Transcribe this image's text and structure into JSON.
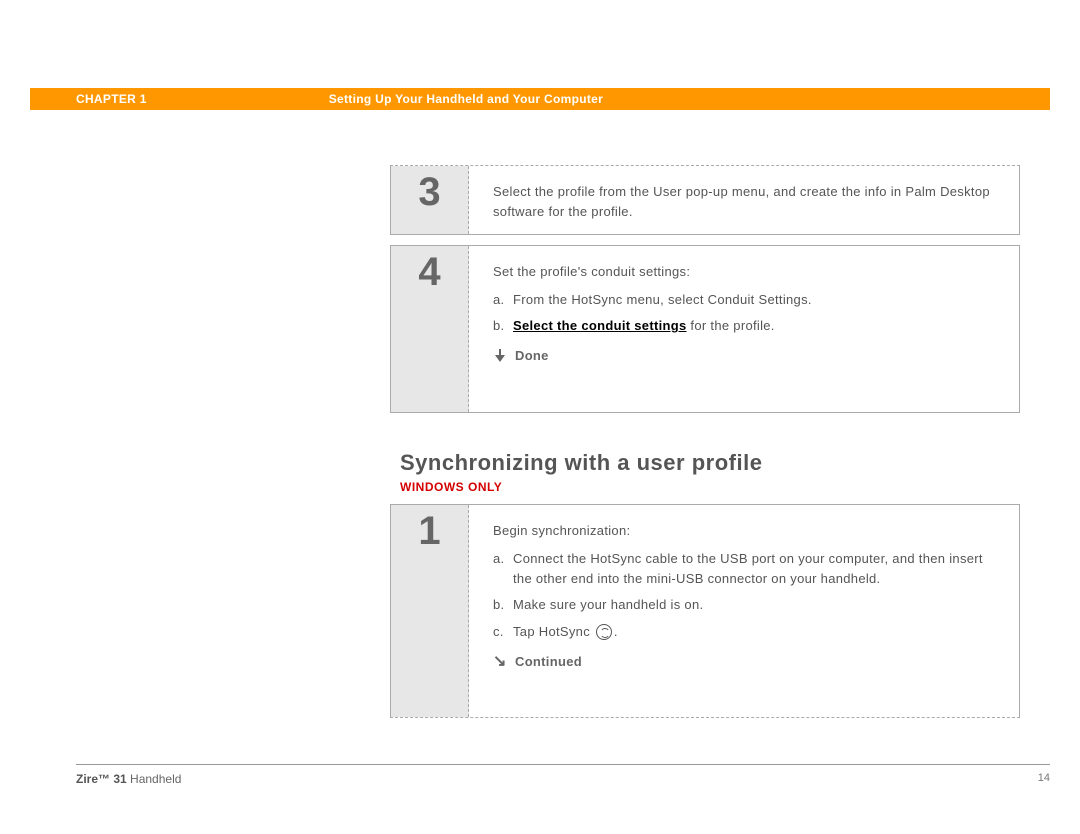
{
  "header": {
    "chapter": "CHAPTER 1",
    "title": "Setting Up Your Handheld and Your Computer"
  },
  "step3": {
    "num": "3",
    "text": "Select the profile from the User pop-up menu, and create the info in Palm Desktop software for the profile."
  },
  "step4": {
    "num": "4",
    "intro": "Set the profile's conduit settings:",
    "a": "From the HotSync menu, select Conduit Settings.",
    "b_link": "Select the conduit settings",
    "b_suffix": " for the profile.",
    "done": "Done"
  },
  "section": {
    "heading": "Synchronizing with a user profile",
    "tag": "WINDOWS ONLY"
  },
  "step1": {
    "num": "1",
    "intro": "Begin synchronization:",
    "a": "Connect the HotSync cable to the USB port on your computer, and then insert the other end into the mini-USB connector on your handheld.",
    "b": "Make sure your handheld is on.",
    "c_prefix": "Tap HotSync ",
    "c_suffix": ".",
    "continued": "Continued"
  },
  "footer": {
    "product_bold": "Zire™ 31",
    "product_rest": " Handheld",
    "page": "14"
  }
}
